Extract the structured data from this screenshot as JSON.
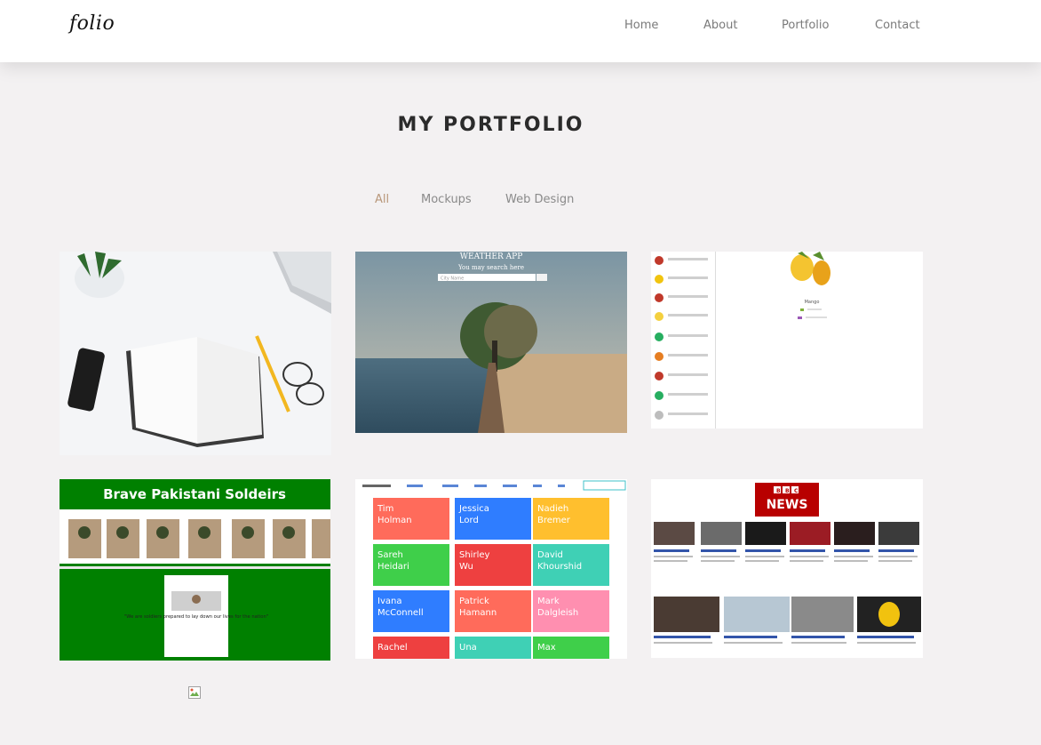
{
  "brand": {
    "logo": "folio"
  },
  "nav": {
    "home": "Home",
    "about": "About",
    "portfolio": "Portfolio",
    "contact": "Contact"
  },
  "section": {
    "title": "MY PORTFOLIO"
  },
  "filters": {
    "all": "All",
    "mockups": "Mockups",
    "web_design": "Web Design"
  },
  "colors": {
    "accent": "#b8977a",
    "background": "#f3f1f2"
  },
  "portfolio": {
    "weather": {
      "title": "WEATHER APP",
      "subtitle": "You may search here",
      "placeholder": "City Name"
    },
    "fruits": {
      "selected": "Mango"
    },
    "soldiers": {
      "title": "Brave Pakistani Soldeirs",
      "caption": "\"We are soldiers prepared to lay down our lives for the nation\""
    },
    "contacts": {
      "tiles": [
        "Tim Holman",
        "Jessica Lord",
        "Nadieh Bremer",
        "Sareh Heidari",
        "Shirley Wu",
        "David Khourshid",
        "Ivana McConnell",
        "Patrick Hamann",
        "Mark Dalgleish",
        "Rachel",
        "Una",
        "Max"
      ]
    },
    "news": {
      "logo_top": "BBC",
      "logo_bottom": "NEWS"
    }
  }
}
